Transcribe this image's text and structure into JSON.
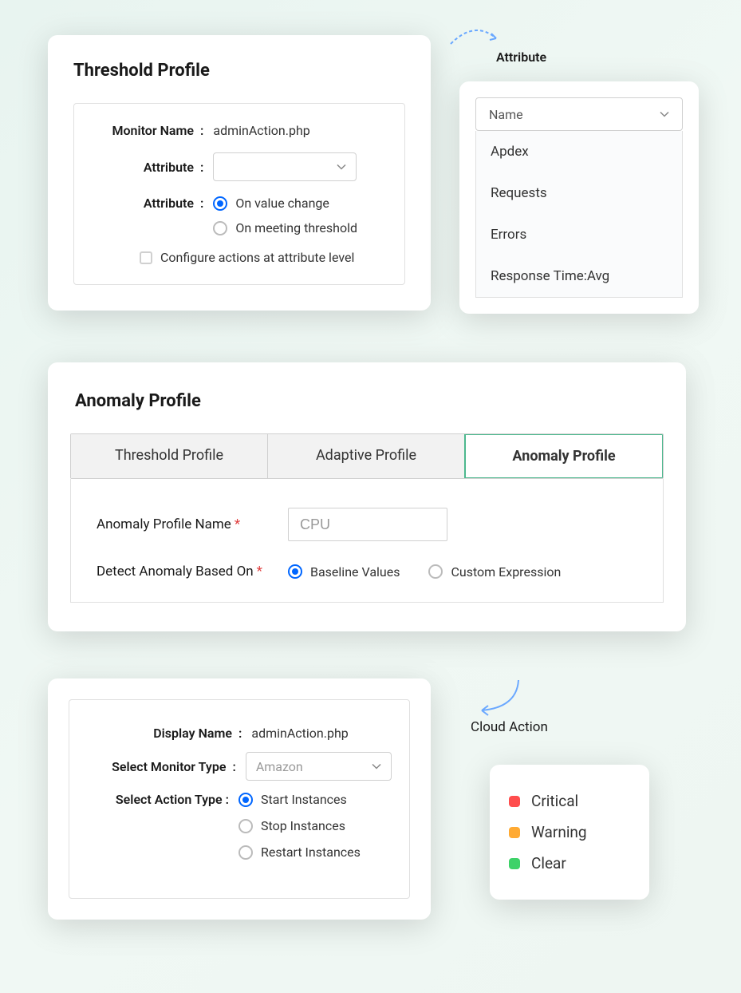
{
  "threshold": {
    "title": "Threshold Profile",
    "monitor_name_label": "Monitor Name",
    "monitor_name_value": "adminAction.php",
    "attribute_label": "Attribute",
    "trigger_label": "Attribute",
    "trigger_options": {
      "on_value_change": "On value change",
      "on_meeting_threshold": "On meeting threshold"
    },
    "configure_actions_label": "Configure actions at attribute level"
  },
  "attribute_callout": "Attribute",
  "dropdown": {
    "header": "Name",
    "items": [
      "Apdex",
      "Requests",
      "Errors",
      "Response Time:Avg"
    ]
  },
  "anomaly": {
    "title": "Anomaly Profile",
    "tabs": {
      "threshold": "Threshold Profile",
      "adaptive": "Adaptive Profile",
      "anomaly": "Anomaly Profile"
    },
    "name_label": "Anomaly Profile Name",
    "name_value": "CPU",
    "detect_label": "Detect Anomaly  Based On",
    "detect_options": {
      "baseline": "Baseline Values",
      "custom": "Custom Expression"
    }
  },
  "cloud": {
    "callout": "Cloud Action",
    "display_name_label": "Display  Name",
    "display_name_value": "adminAction.php",
    "monitor_type_label": "Select Monitor Type",
    "monitor_type_value": "Amazon",
    "action_type_label": "Select Action Type :",
    "action_options": {
      "start": "Start Instances",
      "stop": "Stop Instances",
      "restart": "Restart Instances"
    }
  },
  "legend": {
    "critical": "Critical",
    "warning": "Warning",
    "clear": "Clear"
  }
}
